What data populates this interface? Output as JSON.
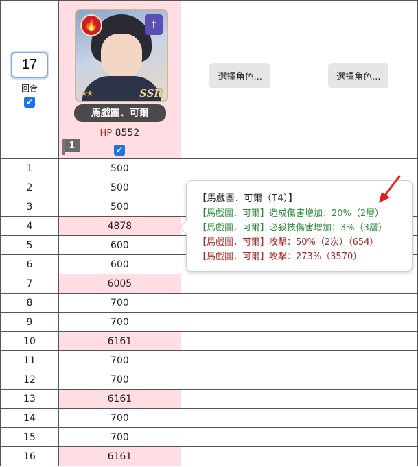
{
  "round": {
    "value": "17",
    "label": "回合"
  },
  "hero": {
    "name": "馬戲團．可爾",
    "hp_label": "HP",
    "hp_value": "8552",
    "rarity": "SSR",
    "stars": "★★",
    "slot_number": "1",
    "element_icon": "fire-icon",
    "class_icon": "sword-icon"
  },
  "select_buttons": [
    "選擇角色...",
    "選擇角色..."
  ],
  "rows": [
    {
      "round": "1",
      "value": "500",
      "highlight": false
    },
    {
      "round": "2",
      "value": "500",
      "highlight": false
    },
    {
      "round": "3",
      "value": "500",
      "highlight": false
    },
    {
      "round": "4",
      "value": "4878",
      "highlight": true
    },
    {
      "round": "5",
      "value": "600",
      "highlight": false
    },
    {
      "round": "6",
      "value": "600",
      "highlight": false
    },
    {
      "round": "7",
      "value": "6005",
      "highlight": true
    },
    {
      "round": "8",
      "value": "700",
      "highlight": false
    },
    {
      "round": "9",
      "value": "700",
      "highlight": false
    },
    {
      "round": "10",
      "value": "6161",
      "highlight": true
    },
    {
      "round": "11",
      "value": "700",
      "highlight": false
    },
    {
      "round": "12",
      "value": "700",
      "highlight": false
    },
    {
      "round": "13",
      "value": "6161",
      "highlight": true
    },
    {
      "round": "14",
      "value": "700",
      "highlight": false
    },
    {
      "round": "15",
      "value": "700",
      "highlight": false
    },
    {
      "round": "16",
      "value": "6161",
      "highlight": true
    }
  ],
  "tooltip": {
    "title": "【馬戲團．可爾（T4）】",
    "lines": [
      {
        "text": "【馬戲團．可爾】造成傷害增加：20%（2層）",
        "color": "green"
      },
      {
        "text": "【馬戲團．可爾】必殺技傷害增加：3%（3層）",
        "color": "green"
      },
      {
        "text": "【馬戲團．可爾】攻擊：50%（2次）（654）",
        "color": "red"
      },
      {
        "text": "【馬戲團．可爾】攻擊：273%（3570）",
        "color": "red"
      }
    ]
  },
  "colors": {
    "highlight": "#ffdde2",
    "accent": "#1a73e8",
    "buff": "#2e8b3c",
    "attack": "#a52a2a",
    "annotation": "#e0201c"
  }
}
